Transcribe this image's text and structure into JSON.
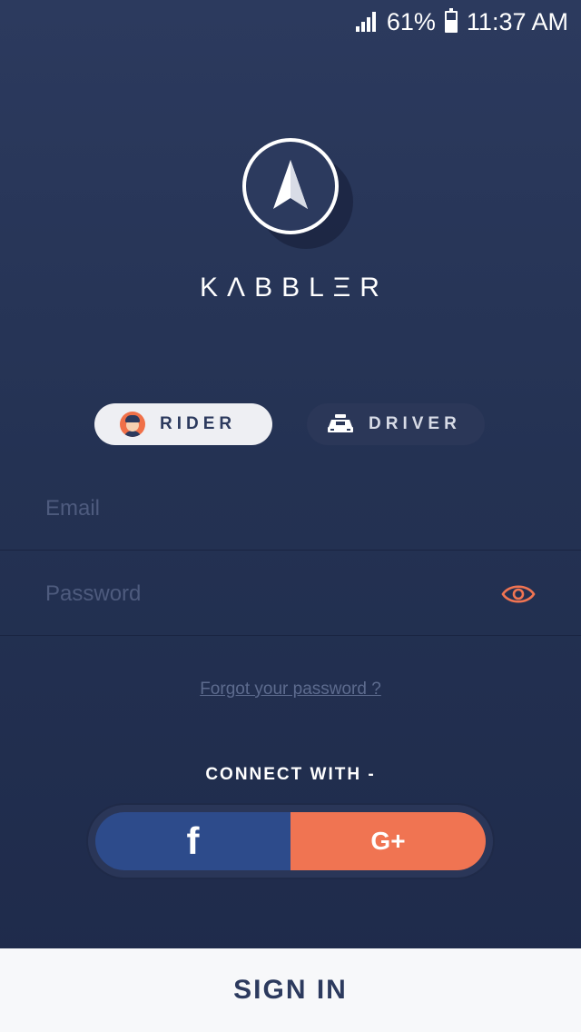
{
  "status_bar": {
    "battery_percent": "61%",
    "time": "11:37 AM",
    "signal_icon": "signal-icon",
    "battery_icon": "battery-icon"
  },
  "brand": {
    "name": "KΛBBLΞR",
    "logo_icon": "compass-arrow-icon"
  },
  "roles": [
    {
      "label": "RIDER",
      "icon": "rider-avatar-icon",
      "selected": true
    },
    {
      "label": "DRIVER",
      "icon": "taxi-icon",
      "selected": false
    }
  ],
  "form": {
    "email": {
      "placeholder": "Email",
      "value": ""
    },
    "password": {
      "placeholder": "Password",
      "value": "",
      "toggle_icon": "eye-icon"
    },
    "forgot_link": "Forgot your password ?"
  },
  "social": {
    "label": "CONNECT WITH -",
    "facebook": {
      "glyph": "f",
      "color": "#2d4b8b"
    },
    "google": {
      "glyph": "G+",
      "color": "#f07452"
    }
  },
  "sign_in_label": "SIGN IN",
  "colors": {
    "accent": "#f07452",
    "background": "#243253",
    "facebook": "#2d4b8b"
  }
}
